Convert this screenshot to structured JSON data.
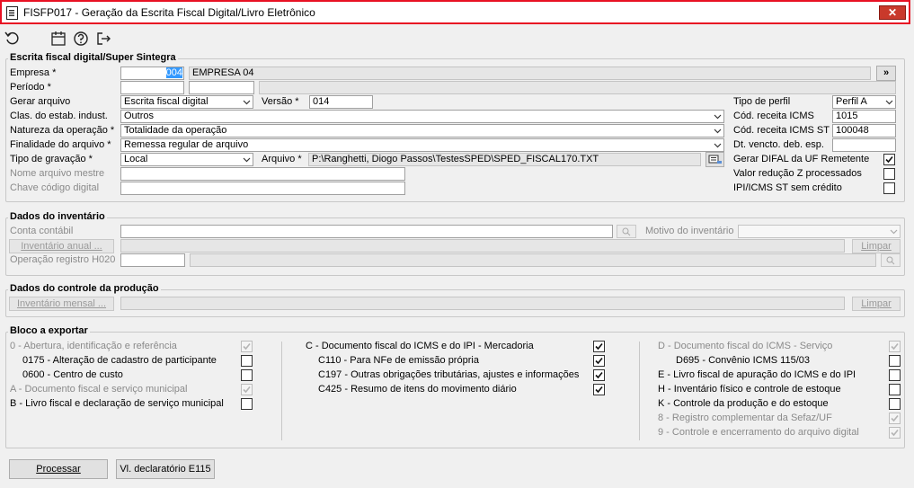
{
  "window": {
    "title": "FISFP017 - Geração da Escrita Fiscal Digital/Livro Eletrônico",
    "close_glyph": "✕"
  },
  "toolbar": {
    "icons": [
      "refresh-icon",
      "calendar-icon",
      "help-icon",
      "exit-icon"
    ]
  },
  "escrita": {
    "title": "Escrita fiscal digital/Super Sintegra",
    "empresa_label": "Empresa *",
    "empresa_code": "004",
    "empresa_name": "EMPRESA 04",
    "more_button": "»",
    "periodo_label": "Período *",
    "gerar_label": "Gerar arquivo",
    "gerar_value": "Escrita fiscal digital",
    "versao_label": "Versão *",
    "versao_value": "014",
    "clas_label": "Clas. do estab. indust.",
    "clas_value": "Outros",
    "natureza_label": "Natureza da operação *",
    "natureza_value": "Totalidade da operação",
    "finalidade_label": "Finalidade do arquivo *",
    "finalidade_value": "Remessa regular de arquivo",
    "tipo_grav_label": "Tipo de gravação *",
    "tipo_grav_value": "Local",
    "arquivo_label": "Arquivo *",
    "arquivo_value": "P:\\Ranghetti, Diogo Passos\\TestesSPED\\SPED_FISCAL170.TXT",
    "nome_mestre_label": "Nome arquivo mestre",
    "chave_label": "Chave código digital",
    "tipo_perfil_label": "Tipo de perfil",
    "tipo_perfil_value": "Perfil A",
    "cod_icms_label": "Cód. receita ICMS",
    "cod_icms_value": "1015",
    "cod_icms_st_label": "Cód. receita ICMS ST",
    "cod_icms_st_value": "100048",
    "dt_vencto_label": "Dt. vencto. deb. esp.",
    "difal_label": "Gerar DIFAL da UF Remetente",
    "difal_checked": true,
    "reducao_label": "Valor redução Z processados",
    "reducao_checked": false,
    "ipi_label": "IPI/ICMS ST sem crédito",
    "ipi_checked": false
  },
  "inventario": {
    "title": "Dados do inventário",
    "conta_label": "Conta contábil",
    "motivo_label": "Motivo do inventário",
    "anual_button": "Inventário anual ...",
    "limpar_button": "Limpar",
    "h020_label": "Operação registro H020"
  },
  "producao": {
    "title": "Dados do controle da produção",
    "mensal_button": "Inventário mensal ...",
    "limpar_button": "Limpar"
  },
  "bloco": {
    "title": "Bloco a exportar",
    "col1": [
      {
        "label": "0 - Abertura, identificação e referência",
        "checked": true,
        "disabled": true
      },
      {
        "label": "0175 - Alteração de cadastro de participante",
        "checked": false,
        "disabled": false
      },
      {
        "label": "0600 - Centro de custo",
        "checked": false,
        "disabled": false
      },
      {
        "label": "A - Documento fiscal e serviço municipal",
        "checked": true,
        "disabled": true
      },
      {
        "label": "B - Livro fiscal e declaração de serviço municipal",
        "checked": false,
        "disabled": false
      }
    ],
    "col2": [
      {
        "label": "C - Documento fiscal do ICMS e do IPI - Mercadoria",
        "checked": true,
        "disabled": false
      },
      {
        "label": "C110 - Para NFe de emissão própria",
        "checked": true,
        "disabled": false
      },
      {
        "label": "C197 - Outras obrigações tributárias, ajustes e informações",
        "checked": true,
        "disabled": false
      },
      {
        "label": "C425 - Resumo de itens do movimento diário",
        "checked": true,
        "disabled": false
      }
    ],
    "col3": [
      {
        "label": "D - Documento fiscal do ICMS - Serviço",
        "checked": true,
        "disabled": true
      },
      {
        "label": "D695 - Convênio ICMS 115/03",
        "checked": false,
        "disabled": false
      },
      {
        "label": "E - Livro fiscal de apuração do ICMS e do IPI",
        "checked": false,
        "disabled": false
      },
      {
        "label": "H - Inventário físico e controle de estoque",
        "checked": false,
        "disabled": false
      },
      {
        "label": "K - Controle da produção e do estoque",
        "checked": false,
        "disabled": false
      },
      {
        "label": "8 - Registro complementar da Sefaz/UF",
        "checked": true,
        "disabled": true
      },
      {
        "label": "9 - Controle e encerramento do arquivo digital",
        "checked": true,
        "disabled": true
      }
    ]
  },
  "footer": {
    "processar_button": "Processar",
    "e115_button": "Vl. declaratório E115"
  },
  "colors": {
    "title_border": "#e81123",
    "close_bg": "#c9392b",
    "selection": "#3399ff"
  }
}
